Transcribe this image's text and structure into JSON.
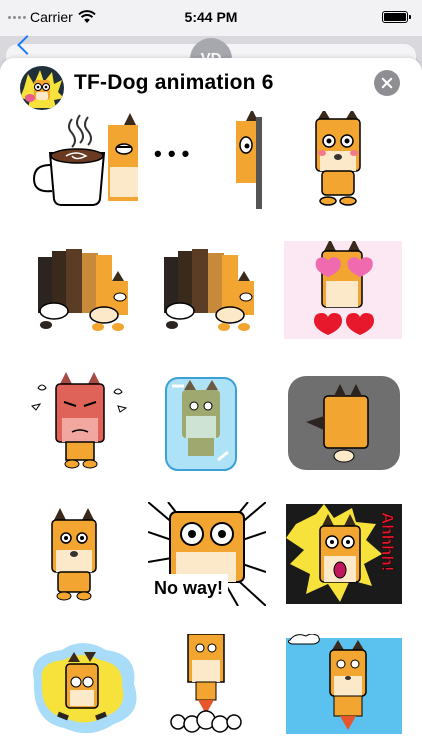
{
  "status_bar": {
    "carrier": "Carrier",
    "time": "5:44 PM"
  },
  "conversation": {
    "contact_initials": "VD"
  },
  "sheet": {
    "title": "TF-Dog animation 6"
  },
  "stickers": [
    {
      "name": "coffee"
    },
    {
      "name": "dots-peek",
      "text": "• • •"
    },
    {
      "name": "blush"
    },
    {
      "name": "marching-dogs-1"
    },
    {
      "name": "marching-dogs-2"
    },
    {
      "name": "heart-eyes"
    },
    {
      "name": "angry"
    },
    {
      "name": "frozen"
    },
    {
      "name": "upside-down"
    },
    {
      "name": "neutral"
    },
    {
      "name": "no-way",
      "text": "No way!"
    },
    {
      "name": "ahhhh",
      "text": "Ahhhh!"
    },
    {
      "name": "glow"
    },
    {
      "name": "rocket"
    },
    {
      "name": "sky"
    }
  ],
  "colors": {
    "dog_orange": "#f2a531",
    "dog_cream": "#fbe9c9",
    "ear_dark": "#3a2a1c",
    "accent_blue": "#1a7cf5",
    "close_gray": "#8e8e93"
  }
}
